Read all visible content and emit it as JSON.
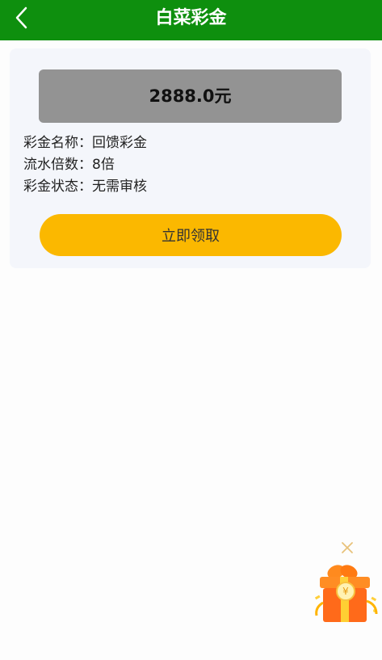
{
  "header": {
    "title": "白菜彩金"
  },
  "bonus": {
    "amount": "2888.0元",
    "rows": [
      {
        "label": "彩金名称：",
        "value": "回馈彩金"
      },
      {
        "label": "流水倍数：",
        "value": "8倍"
      },
      {
        "label": "彩金状态：",
        "value": "无需审核"
      }
    ],
    "claim_label": "立即领取"
  },
  "colors": {
    "header_bg": "#0e8f0e",
    "button_bg": "#fbb800",
    "amount_bg": "#939393"
  },
  "icons": {
    "back": "back-arrow-icon",
    "gift": "gift-box-icon",
    "close": "close-icon"
  }
}
